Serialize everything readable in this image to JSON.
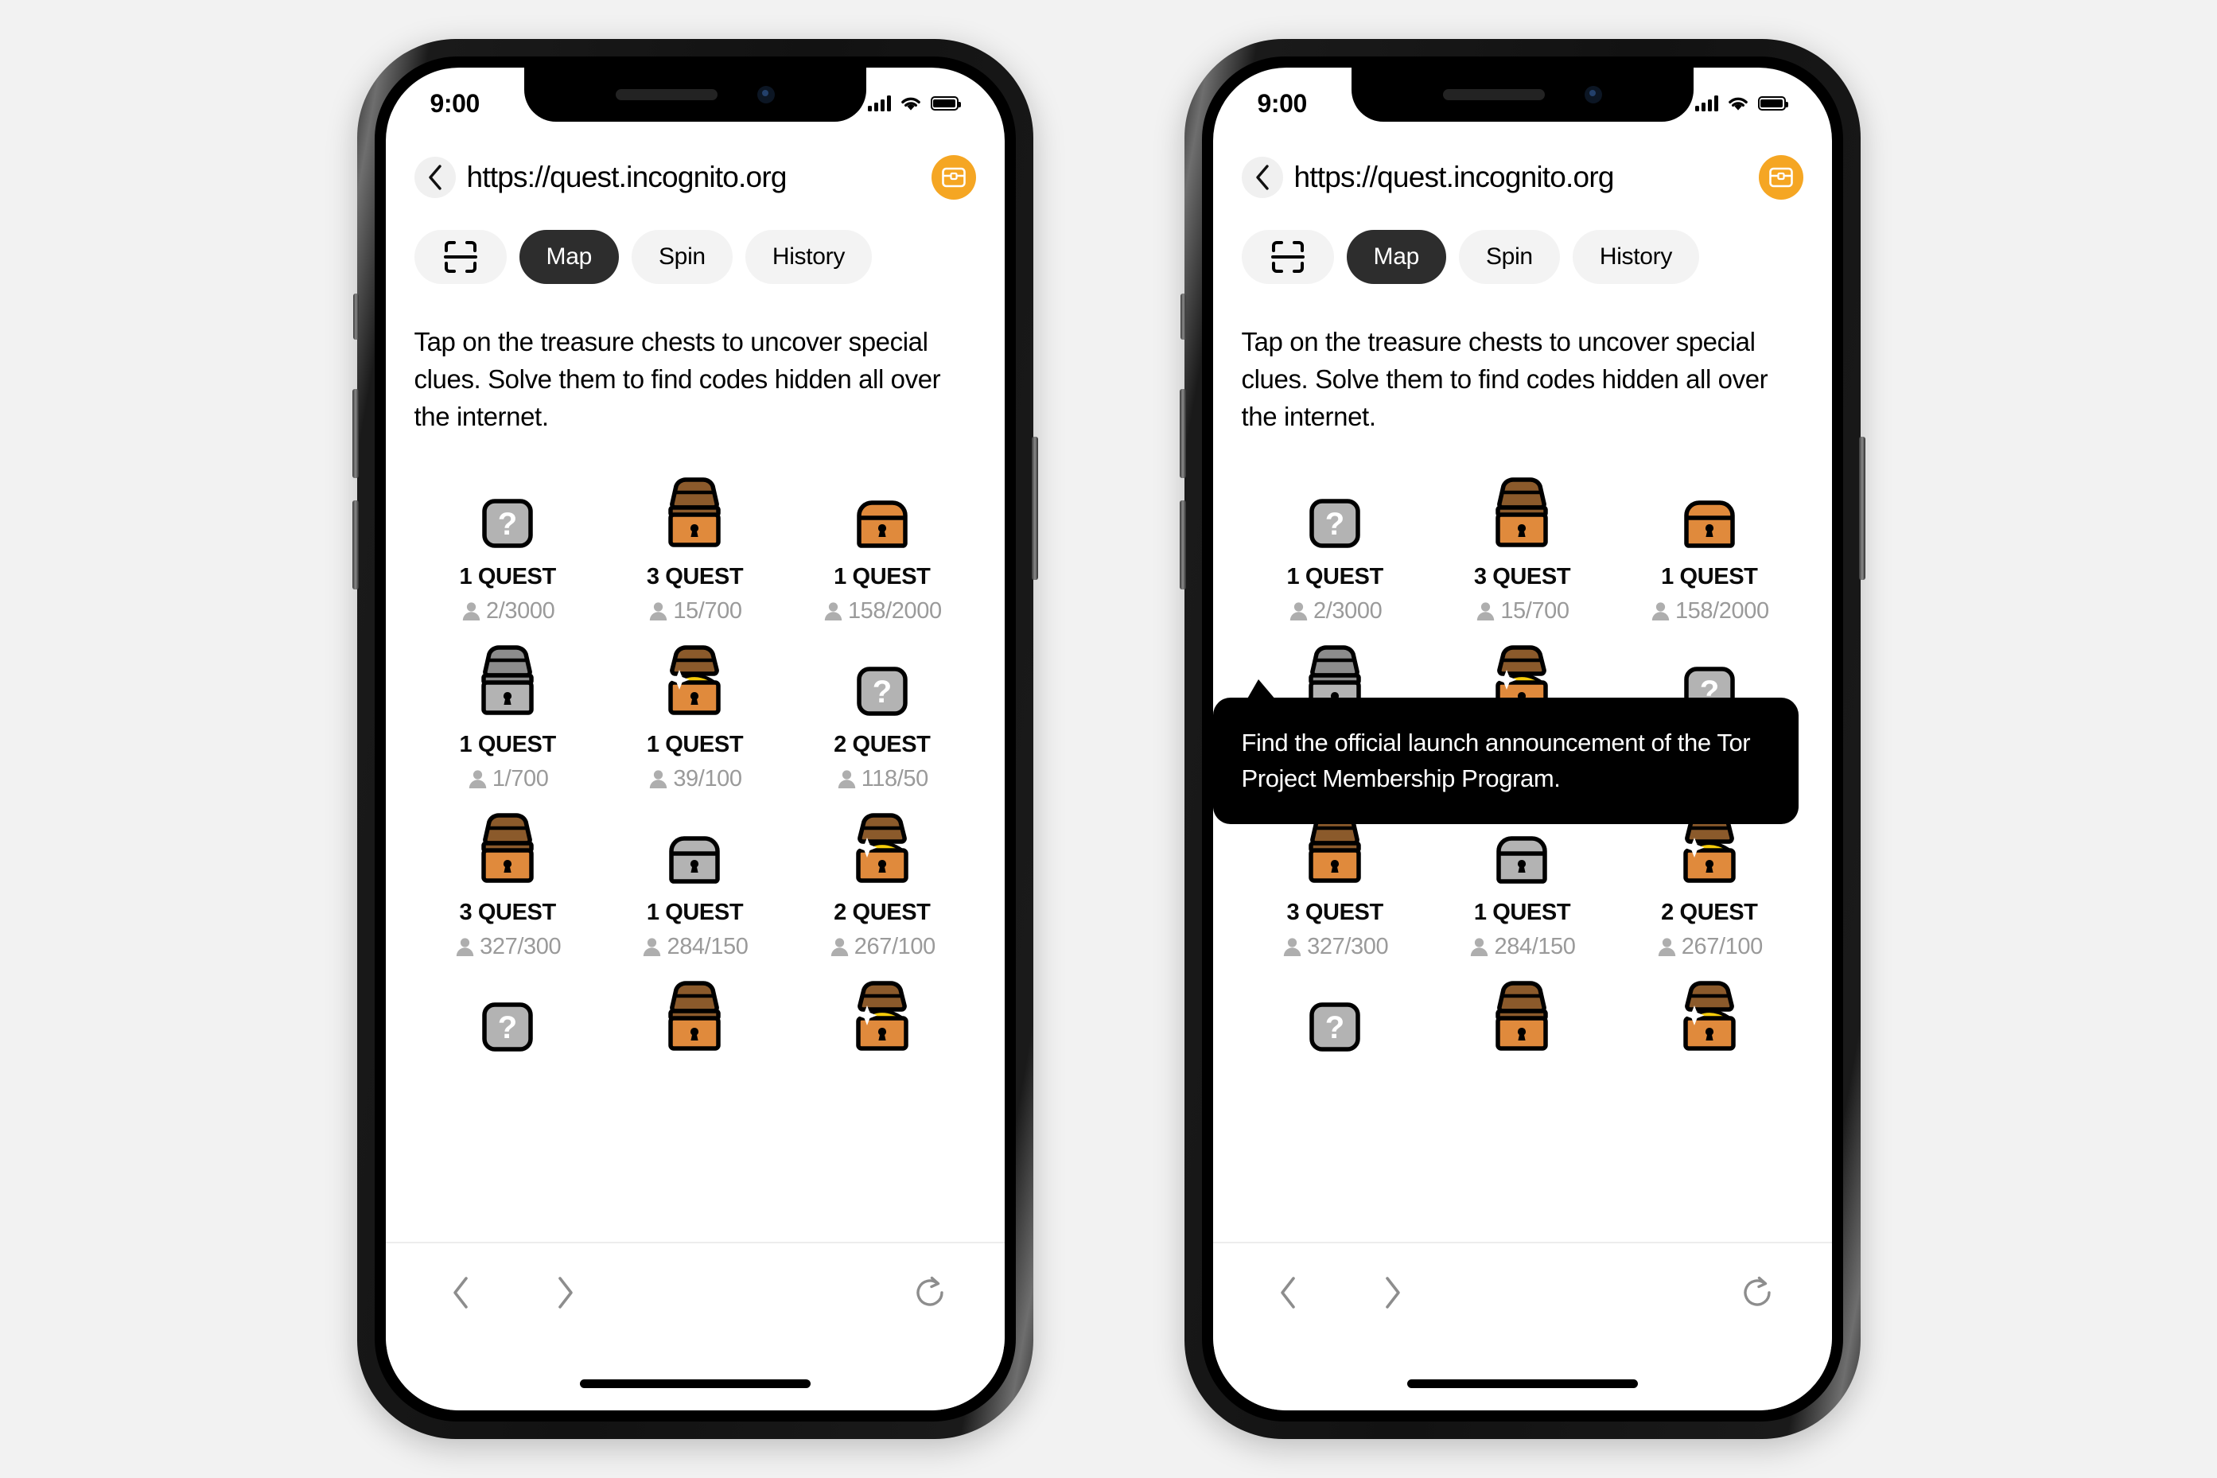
{
  "status": {
    "time": "9:00",
    "signal_icon": "cellular-bars-icon",
    "wifi_icon": "wifi-icon",
    "battery_icon": "battery-full-icon"
  },
  "browser": {
    "back_icon": "chevron-left-icon",
    "url": "https://quest.incognito.org",
    "fab_icon": "treasure-chest-icon",
    "accent_color": "#F5A623"
  },
  "tabs": [
    {
      "id": "scan",
      "label": "",
      "icon": "scan-qr-icon",
      "active": false
    },
    {
      "id": "map",
      "label": "Map",
      "icon": "",
      "active": true
    },
    {
      "id": "spin",
      "label": "Spin",
      "icon": "",
      "active": false
    },
    {
      "id": "history",
      "label": "History",
      "icon": "",
      "active": false
    }
  ],
  "main": {
    "intro": "Tap on the treasure chests to uncover special clues. Solve them to find codes hidden all over the internet.",
    "participant_icon": "person-icon",
    "chests": [
      {
        "type": "mystery",
        "quests": "1 QUEST",
        "count": "2/3000"
      },
      {
        "type": "open-brown",
        "quests": "3 QUEST",
        "count": "15/700"
      },
      {
        "type": "closed-brown",
        "quests": "1 QUEST",
        "count": "158/2000"
      },
      {
        "type": "open-grey",
        "quests": "1 QUEST",
        "count": "1/700"
      },
      {
        "type": "gold",
        "quests": "1 QUEST",
        "count": "39/100"
      },
      {
        "type": "mystery",
        "quests": "2 QUEST",
        "count": "118/50"
      },
      {
        "type": "open-brown",
        "quests": "3 QUEST",
        "count": "327/300"
      },
      {
        "type": "closed-grey",
        "quests": "1 QUEST",
        "count": "284/150"
      },
      {
        "type": "gold",
        "quests": "2 QUEST",
        "count": "267/100"
      },
      {
        "type": "mystery",
        "quests": "",
        "count": ""
      },
      {
        "type": "open-brown",
        "quests": "",
        "count": ""
      },
      {
        "type": "gold",
        "quests": "",
        "count": ""
      }
    ]
  },
  "tooltip": {
    "visible_on": "phone-2",
    "text": "Find the official launch announcement of the Tor Project Membership Program."
  },
  "bottom_nav": {
    "back_icon": "chevron-left-icon",
    "forward_icon": "chevron-right-icon",
    "reload_icon": "reload-icon",
    "home_indicator": "home-indicator"
  },
  "colors": {
    "chest_brown_body": "#E08A3C",
    "chest_brown_lid": "#8B5A2B",
    "chest_grey_body": "#B3B3B3",
    "chest_grey_lid": "#8C8C8C",
    "gold": "#F5CC0A",
    "outline": "#000000",
    "tab_active_bg": "#2D2D2D",
    "tab_inactive_bg": "#F3F3F3"
  }
}
